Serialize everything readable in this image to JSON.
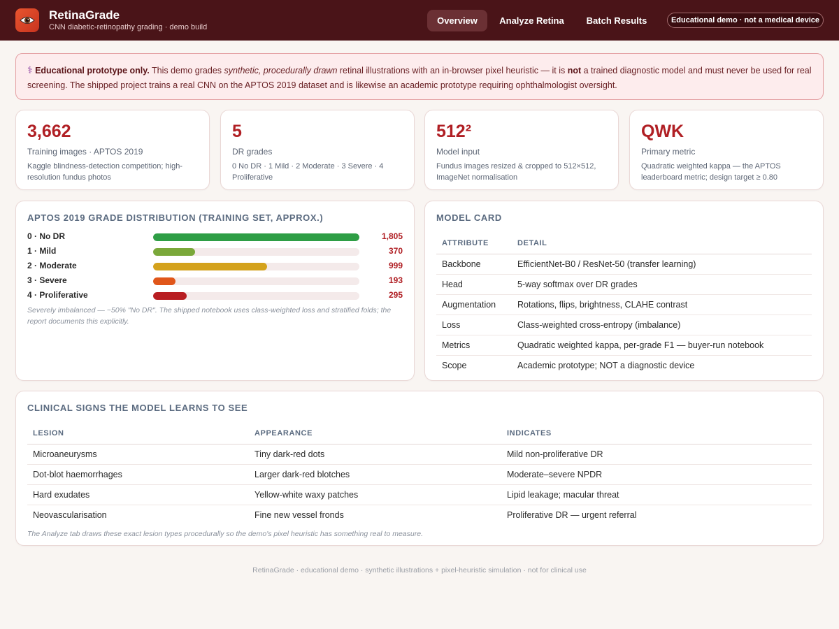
{
  "header": {
    "brand_title": "RetinaGrade",
    "brand_subtitle": "CNN diabetic-retinopathy grading · demo build",
    "nav": [
      {
        "label": "Overview",
        "active": true
      },
      {
        "label": "Analyze Retina",
        "active": false
      },
      {
        "label": "Batch Results",
        "active": false
      }
    ],
    "badge": "Educational demo · not a medical device"
  },
  "alert": {
    "icon": "⚕",
    "strong": "Educational prototype only.",
    "t1": " This demo grades ",
    "em": "synthetic, procedurally drawn",
    "t2": " retinal illustrations with an in-browser pixel heuristic — it is ",
    "not": "not",
    "t3": " a trained diagnostic model and must never be used for real screening. The shipped project trains a real CNN on the APTOS 2019 dataset and is likewise an academic prototype requiring ophthalmologist oversight."
  },
  "stats": [
    {
      "value": "3,662",
      "label": "Training images · APTOS 2019",
      "desc": "Kaggle blindness-detection competition; high-resolution fundus photos"
    },
    {
      "value": "5",
      "label": "DR grades",
      "desc": "0 No DR · 1 Mild · 2 Moderate · 3 Severe · 4 Proliferative"
    },
    {
      "value": "512²",
      "label": "Model input",
      "desc": "Fundus images resized & cropped to 512×512, ImageNet normalisation"
    },
    {
      "value": "QWK",
      "label": "Primary metric",
      "desc": "Quadratic weighted kappa — the APTOS leaderboard metric; design target ≥ 0.80"
    }
  ],
  "distribution": {
    "title": "APTOS 2019 grade distribution (training set, approx.)",
    "max": 1805,
    "rows": [
      {
        "label": "0 · No DR",
        "value": 1805,
        "display": "1,805",
        "color": "#2e9e45"
      },
      {
        "label": "1 · Mild",
        "value": 370,
        "display": "370",
        "color": "#7aa83a"
      },
      {
        "label": "2 · Moderate",
        "value": 999,
        "display": "999",
        "color": "#d4a21c"
      },
      {
        "label": "3 · Severe",
        "value": 193,
        "display": "193",
        "color": "#e0561a"
      },
      {
        "label": "4 · Proliferative",
        "value": 295,
        "display": "295",
        "color": "#b81e22"
      }
    ],
    "note": "Severely imbalanced — ~50% \"No DR\". The shipped notebook uses class-weighted loss and stratified folds; the report documents this explicitly."
  },
  "model_card": {
    "title": "Model card",
    "headers": [
      "Attribute",
      "Detail"
    ],
    "rows": [
      [
        "Backbone",
        "EfficientNet-B0 / ResNet-50 (transfer learning)"
      ],
      [
        "Head",
        "5-way softmax over DR grades"
      ],
      [
        "Augmentation",
        "Rotations, flips, brightness, CLAHE contrast"
      ],
      [
        "Loss",
        "Class-weighted cross-entropy (imbalance)"
      ],
      [
        "Metrics",
        "Quadratic weighted kappa, per-grade F1 — buyer-run notebook"
      ],
      [
        "Scope",
        "Academic prototype; NOT a diagnostic device"
      ]
    ]
  },
  "signs": {
    "title": "Clinical signs the model learns to see",
    "headers": [
      "Lesion",
      "Appearance",
      "Indicates"
    ],
    "rows": [
      [
        "Microaneurysms",
        "Tiny dark-red dots",
        "Mild non-proliferative DR"
      ],
      [
        "Dot-blot haemorrhages",
        "Larger dark-red blotches",
        "Moderate–severe NPDR"
      ],
      [
        "Hard exudates",
        "Yellow-white waxy patches",
        "Lipid leakage; macular threat"
      ],
      [
        "Neovascularisation",
        "Fine new vessel fronds",
        "Proliferative DR — urgent referral"
      ]
    ],
    "note": "The Analyze tab draws these exact lesion types procedurally so the demo's pixel heuristic has something real to measure."
  },
  "footer": "RetinaGrade · educational demo · synthetic illustrations + pixel-heuristic simulation · not for clinical use"
}
